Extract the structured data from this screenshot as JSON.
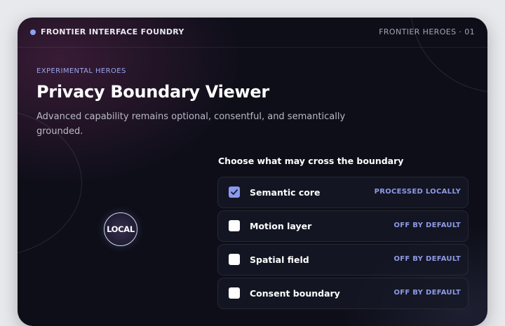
{
  "header": {
    "brand": "FRONTIER INTERFACE FOUNDRY",
    "series_label": "FRONTIER HEROES · 01"
  },
  "hero": {
    "eyebrow": "EXPERIMENTAL HEROES",
    "title": "Privacy Boundary Viewer",
    "subtitle": "Advanced capability remains optional, consentful, and semantically grounded."
  },
  "badge": {
    "label": "LOCAL"
  },
  "boundary": {
    "heading": "Choose what may cross the boundary",
    "options": [
      {
        "label": "Semantic core",
        "status": "PROCESSED LOCALLY",
        "checked": true
      },
      {
        "label": "Motion layer",
        "status": "OFF BY DEFAULT",
        "checked": false
      },
      {
        "label": "Spatial field",
        "status": "OFF BY DEFAULT",
        "checked": false
      },
      {
        "label": "Consent boundary",
        "status": "OFF BY DEFAULT",
        "checked": false
      }
    ]
  },
  "colors": {
    "accent": "#8c99ec",
    "background": "#0d0e18",
    "status_text": "#8e9ae6"
  }
}
